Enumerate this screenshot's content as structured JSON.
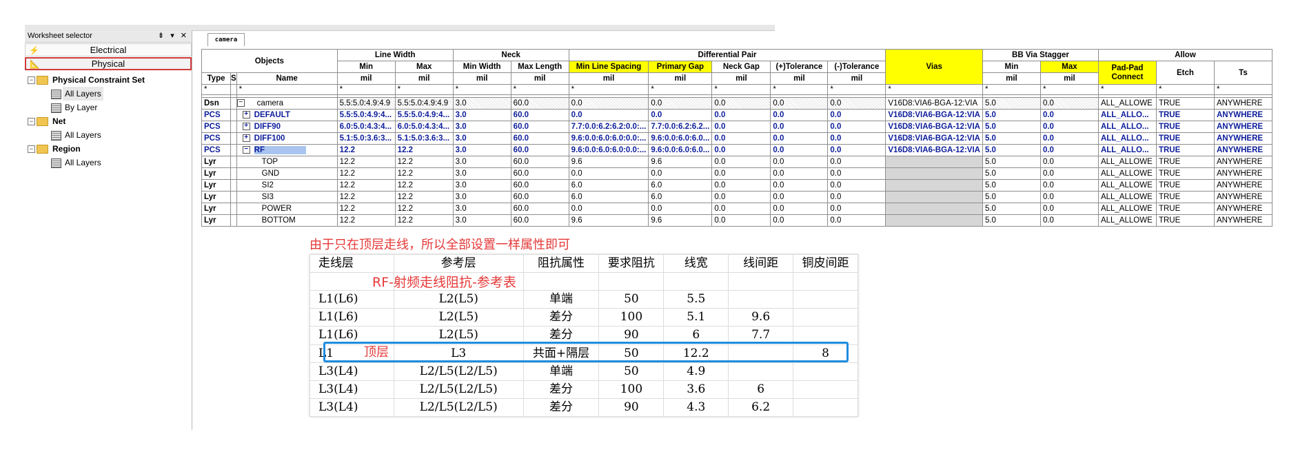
{
  "left_panel": {
    "title": "Worksheet selector",
    "controls": "⇟ ▾ ✕",
    "modes": [
      {
        "label": "Electrical",
        "icon": "lightning-icon",
        "selected": false
      },
      {
        "label": "Physical",
        "icon": "ruler-icon",
        "selected": true
      }
    ],
    "tree": {
      "pcs": {
        "label": "Physical Constraint Set",
        "children": [
          "All Layers",
          "By Layer"
        ]
      },
      "net": {
        "label": "Net",
        "children": [
          "All Layers"
        ]
      },
      "region": {
        "label": "Region",
        "children": [
          "All Layers"
        ]
      }
    }
  },
  "tab": {
    "label": "camera"
  },
  "sheet": {
    "groups": {
      "objects": "Objects",
      "line_width": "Line Width",
      "neck": "Neck",
      "diff_pair": "Differential Pair",
      "vias": "Vias",
      "bb_via": "BB Via Stagger",
      "allow": "Allow"
    },
    "subheaders": {
      "lw_min": "Min",
      "lw_max": "Max",
      "neck_min_width": "Min Width",
      "neck_max_length": "Max Length",
      "dp_min_line_spacing": "Min Line Spacing",
      "dp_primary_gap": "Primary Gap",
      "dp_neck_gap": "Neck Gap",
      "dp_plus_tol": "(+)Tolerance",
      "dp_minus_tol": "(-)Tolerance",
      "bb_min": "Min",
      "bb_max": "Max",
      "pad_pad": "Pad-Pad Connect",
      "etch": "Etch",
      "ts": "Ts",
      "type": "Type",
      "s": "S",
      "name": "Name",
      "unit": "mil",
      "star": "*"
    },
    "rows": [
      {
        "type": "Dsn",
        "name": "camera",
        "toggle": "−",
        "indent": 0,
        "bold": false,
        "blue": false,
        "cells": [
          "5.5:5.0:4.9:4.9",
          "5.5:5.0:4.9:4.9",
          "3.0",
          "60.0",
          "0.0",
          "0.0",
          "0.0",
          "0.0",
          "0.0",
          "V16D8:VIA6-BGA-12:VIA",
          "5.0",
          "0.0",
          "ALL_ALLOWE",
          "TRUE",
          "ANYWHERE"
        ]
      },
      {
        "type": "PCS",
        "name": "DEFAULT",
        "toggle": "+",
        "indent": 1,
        "bold": true,
        "blue": true,
        "cells": [
          "5.5:5.0:4.9:4...",
          "5.5:5.0:4.9:4...",
          "3.0",
          "60.0",
          "0.0",
          "0.0",
          "0.0",
          "0.0",
          "0.0",
          "V16D8:VIA6-BGA-12:VIA",
          "5.0",
          "0.0",
          "ALL_ALLO...",
          "TRUE",
          "ANYWHERE"
        ]
      },
      {
        "type": "PCS",
        "name": "DIFF90",
        "toggle": "+",
        "indent": 1,
        "bold": true,
        "blue": true,
        "cells": [
          "6.0:5.0:4.3:4...",
          "6.0:5.0:4.3:4...",
          "3.0",
          "60.0",
          "7.7:0.0:6.2:6.2:0.0:...",
          "7.7:0.0:6.2:6.2...",
          "0.0",
          "0.0",
          "0.0",
          "V16D8:VIA6-BGA-12:VIA",
          "5.0",
          "0.0",
          "ALL_ALLO...",
          "TRUE",
          "ANYWHERE"
        ]
      },
      {
        "type": "PCS",
        "name": "DIFF100",
        "toggle": "+",
        "indent": 1,
        "bold": true,
        "blue": true,
        "cells": [
          "5.1:5.0:3.6:3...",
          "5.1:5.0:3.6:3...",
          "3.0",
          "60.0",
          "9.6:0.0:6.0:6.0:0.0:...",
          "9.6:0.0:6.0:6.0...",
          "0.0",
          "0.0",
          "0.0",
          "V16D8:VIA6-BGA-12:VIA",
          "5.0",
          "0.0",
          "ALL_ALLO...",
          "TRUE",
          "ANYWHERE"
        ]
      },
      {
        "type": "PCS",
        "name": "RF",
        "toggle": "−",
        "indent": 1,
        "bold": true,
        "blue": true,
        "selected": true,
        "cells": [
          "12.2",
          "12.2",
          "3.0",
          "60.0",
          "9.6:0.0:6.0:6.0:0.0:...",
          "9.6:0.0:6.0:6.0...",
          "0.0",
          "0.0",
          "0.0",
          "V16D8:VIA6-BGA-12:VIA",
          "5.0",
          "0.0",
          "ALL_ALLO...",
          "TRUE",
          "ANYWHERE"
        ]
      },
      {
        "type": "Lyr",
        "name": "TOP",
        "toggle": "",
        "indent": 2,
        "bold": false,
        "blue": false,
        "cells": [
          "12.2",
          "12.2",
          "3.0",
          "60.0",
          "9.6",
          "9.6",
          "0.0",
          "0.0",
          "0.0",
          "",
          "5.0",
          "0.0",
          "ALL_ALLOWE",
          "TRUE",
          "ANYWHERE"
        ]
      },
      {
        "type": "Lyr",
        "name": "GND",
        "toggle": "",
        "indent": 2,
        "bold": false,
        "blue": false,
        "cells": [
          "12.2",
          "12.2",
          "3.0",
          "60.0",
          "0.0",
          "0.0",
          "0.0",
          "0.0",
          "0.0",
          "",
          "5.0",
          "0.0",
          "ALL_ALLOWE",
          "TRUE",
          "ANYWHERE"
        ]
      },
      {
        "type": "Lyr",
        "name": "SI2",
        "toggle": "",
        "indent": 2,
        "bold": false,
        "blue": false,
        "cells": [
          "12.2",
          "12.2",
          "3.0",
          "60.0",
          "6.0",
          "6.0",
          "0.0",
          "0.0",
          "0.0",
          "",
          "5.0",
          "0.0",
          "ALL_ALLOWE",
          "TRUE",
          "ANYWHERE"
        ]
      },
      {
        "type": "Lyr",
        "name": "SI3",
        "toggle": "",
        "indent": 2,
        "bold": false,
        "blue": false,
        "cells": [
          "12.2",
          "12.2",
          "3.0",
          "60.0",
          "6.0",
          "6.0",
          "0.0",
          "0.0",
          "0.0",
          "",
          "5.0",
          "0.0",
          "ALL_ALLOWE",
          "TRUE",
          "ANYWHERE"
        ]
      },
      {
        "type": "Lyr",
        "name": "POWER",
        "toggle": "",
        "indent": 2,
        "bold": false,
        "blue": false,
        "cells": [
          "12.2",
          "12.2",
          "3.0",
          "60.0",
          "0.0",
          "0.0",
          "0.0",
          "0.0",
          "0.0",
          "",
          "5.0",
          "0.0",
          "ALL_ALLOWE",
          "TRUE",
          "ANYWHERE"
        ]
      },
      {
        "type": "Lyr",
        "name": "BOTTOM",
        "toggle": "",
        "indent": 2,
        "bold": false,
        "blue": false,
        "cells": [
          "12.2",
          "12.2",
          "3.0",
          "60.0",
          "9.6",
          "9.6",
          "0.0",
          "0.0",
          "0.0",
          "",
          "5.0",
          "0.0",
          "ALL_ALLOWE",
          "TRUE",
          "ANYWHERE"
        ]
      }
    ]
  },
  "annotation": {
    "note": "由于只在顶层走线，所以全部设置一样属性即可",
    "table_title": "RF-射频走线阻抗-参考表",
    "layer_note": "顶层",
    "headers": [
      "走线层",
      "参考层",
      "阻抗属性",
      "要求阻抗",
      "线宽",
      "线间距",
      "铜皮间距"
    ],
    "rows": [
      [
        "",
        "",
        "",
        "",
        "",
        "",
        ""
      ],
      [
        "L1(L6)",
        "L2(L5)",
        "单端",
        "50",
        "5.5",
        "",
        ""
      ],
      [
        "L1(L6)",
        "L2(L5)",
        "差分",
        "100",
        "5.1",
        "9.6",
        ""
      ],
      [
        "L1(L6)",
        "L2(L5)",
        "差分",
        "90",
        "6",
        "7.7",
        ""
      ],
      [
        "L1",
        "L3",
        "共面+隔层",
        "50",
        "12.2",
        "",
        "8"
      ],
      [
        "L3(L4)",
        "L2/L5(L2/L5)",
        "单端",
        "50",
        "4.9",
        "",
        ""
      ],
      [
        "L3(L4)",
        "L2/L5(L2/L5)",
        "差分",
        "100",
        "3.6",
        "6",
        ""
      ],
      [
        "L3(L4)",
        "L2/L5(L2/L5)",
        "差分",
        "90",
        "4.3",
        "6.2",
        ""
      ]
    ],
    "highlight_color": "#1e8ce0",
    "note_color": "#e53838"
  }
}
